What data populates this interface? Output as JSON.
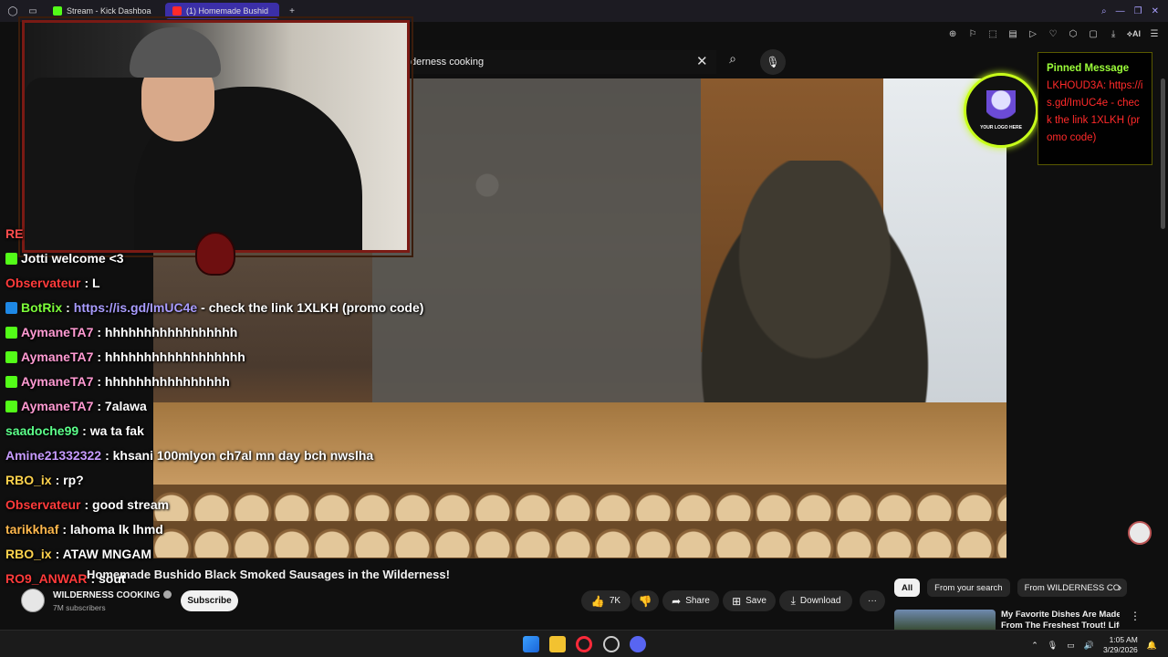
{
  "browser": {
    "tabs": [
      {
        "label": "Stream - Kick Dashboa",
        "favicon_color": "#53fc18",
        "active": false
      },
      {
        "label": "(1) Homemade Bushid",
        "favicon_color": "#ff2a2a",
        "active": true
      }
    ],
    "new_tab": "+",
    "toolbar_ai_label": "AI"
  },
  "search": {
    "query": "derness cooking"
  },
  "chat": {
    "lines": [
      {
        "user": "RE",
        "message": "",
        "color": "#ff4d4d",
        "badge": null
      },
      {
        "user": "Jotti",
        "message": "welcome <3",
        "color": "#ffffff",
        "badge": "#53fc18"
      },
      {
        "user": "Observateur",
        "message": ": L",
        "color": "#ff3b3b",
        "badge": null
      },
      {
        "user": "BotRix",
        "message": ":",
        "link": "https://is.gd/ImUC4e",
        "after": "- check the link 1XLKH (promo code)",
        "color": "#7dff3a",
        "badge": "#1e88e5"
      },
      {
        "user": "AymaneTA7",
        "message": ": hhhhhhhhhhhhhhhhh",
        "color": "#ff9ad2",
        "badge": "#53fc18"
      },
      {
        "user": "AymaneTA7",
        "message": ": hhhhhhhhhhhhhhhhhh",
        "color": "#ff9ad2",
        "badge": "#53fc18"
      },
      {
        "user": "AymaneTA7",
        "message": ": hhhhhhhhhhhhhhhh",
        "color": "#ff9ad2",
        "badge": "#53fc18"
      },
      {
        "user": "AymaneTA7",
        "message": ": 7alawa",
        "color": "#ff9ad2",
        "badge": "#53fc18"
      },
      {
        "user": "saadoche99",
        "message": ": wa ta fak",
        "color": "#5cff8a",
        "badge": null
      },
      {
        "user": "Amine21332322",
        "message": ": khsani 100mlyon ch7al mn day bch nwslha",
        "color": "#c79bff",
        "badge": null
      },
      {
        "user": "RBO_ix",
        "message": ": rp?",
        "color": "#ffd34d",
        "badge": null
      },
      {
        "user": "Observateur",
        "message": ": good stream",
        "color": "#ff3b3b",
        "badge": null
      },
      {
        "user": "tarikkhaf",
        "message": ": lahoma lk lhmd",
        "color": "#ffb84d",
        "badge": null
      },
      {
        "user": "RBO_ix",
        "message": ": ATAW MNGAM",
        "color": "#ffd34d",
        "badge": null
      },
      {
        "user": "RO9_ANWAR",
        "message": ": sout",
        "color": "#ff3b3b",
        "badge": null
      }
    ]
  },
  "pinned": {
    "title": "Pinned Message",
    "body": "LKHOUD3A: https://is.gd/ImUC4e - check the link 1XLKH (promo code)"
  },
  "logo_badge_text": "YOUR LOGO HERE",
  "video": {
    "title": "Homemade Bushido Black Smoked Sausages in the Wilderness!",
    "channel": "WILDERNESS COOKING",
    "subscribers": "7M subscribers",
    "subscribe_label": "Subscribe",
    "likes": "7K",
    "share_label": "Share",
    "save_label": "Save",
    "download_label": "Download",
    "more_label": "···"
  },
  "chips": [
    "All",
    "From your search",
    "From WILDERNESS CO"
  ],
  "recommendation": {
    "title_line1": "My Favorite Dishes Are Made",
    "title_line2": "From The Freshest Trout! Life I"
  },
  "taskbar": {
    "time": "1:05 AM",
    "date": "3/29/2026"
  },
  "colors": {
    "accent": "#3b2fa8",
    "pinned_title": "#9cff3a",
    "pinned_body": "#ff2a2a",
    "logo_ring": "#c8ff1a"
  }
}
